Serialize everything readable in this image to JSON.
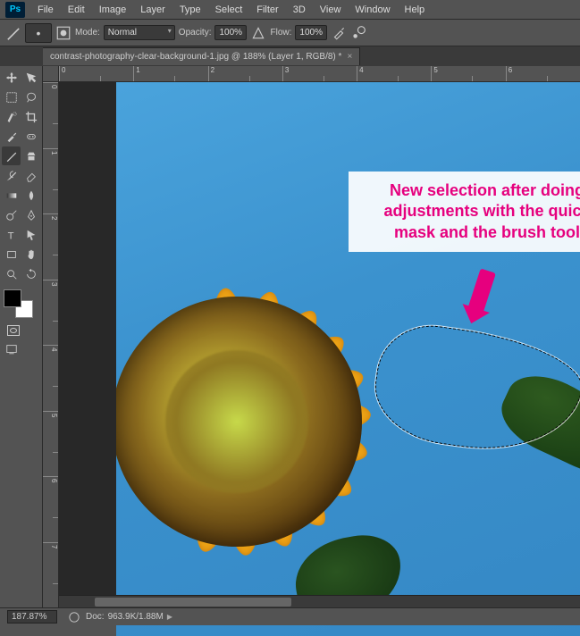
{
  "app": {
    "logo": "Ps"
  },
  "menu": [
    "File",
    "Edit",
    "Image",
    "Layer",
    "Type",
    "Select",
    "Filter",
    "3D",
    "View",
    "Window",
    "Help"
  ],
  "options": {
    "brush_size": "20",
    "mode_label": "Mode:",
    "mode_value": "Normal",
    "opacity_label": "Opacity:",
    "opacity_value": "100%",
    "flow_label": "Flow:",
    "flow_value": "100%"
  },
  "tab": {
    "title": "contrast-photography-clear-background-1.jpg @ 188% (Layer 1, RGB/8) *"
  },
  "ruler_h": [
    "0",
    "1",
    "2",
    "3",
    "4",
    "5",
    "6"
  ],
  "ruler_v": [
    "0",
    "1",
    "2",
    "3",
    "4",
    "5",
    "6",
    "7"
  ],
  "annotation": {
    "line1": "New selection after doing",
    "line2": "adjustments with the quick",
    "line3": "mask and the brush tool"
  },
  "status": {
    "zoom": "187.87%",
    "doc_label": "Doc:",
    "doc_value": "963.9K/1.88M"
  },
  "tools": [
    "move-tool",
    "artboard-tool",
    "marquee-tool",
    "lasso-tool",
    "quick-selection-tool",
    "crop-tool",
    "eyedropper-tool",
    "spot-healing-tool",
    "brush-tool",
    "clone-stamp-tool",
    "history-brush-tool",
    "eraser-tool",
    "gradient-tool",
    "blur-tool",
    "dodge-tool",
    "pen-tool",
    "type-tool",
    "path-selection-tool",
    "rectangle-tool",
    "hand-tool",
    "zoom-tool",
    "rotate-tool"
  ]
}
